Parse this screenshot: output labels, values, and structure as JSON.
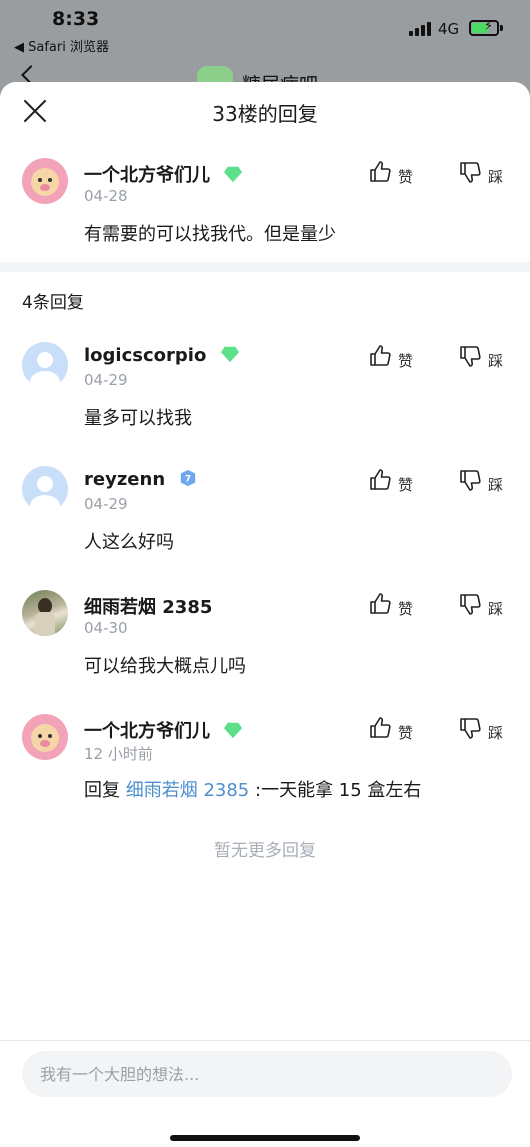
{
  "status": {
    "time": "8:33",
    "back_app": "◀ Safari 浏览器",
    "network": "4G"
  },
  "background": {
    "title": "糖尿病吧"
  },
  "sheet": {
    "title": "33楼的回复",
    "reply_count": "4条回复",
    "no_more": "暂无更多回复",
    "input_placeholder": "我有一个大胆的想法..."
  },
  "main_comment": {
    "user": "一个北方爷们儿",
    "date": "04-28",
    "text": "有需要的可以找我代。但是量少",
    "badge_color": "#5ee08a"
  },
  "replies": [
    {
      "user": "logicscorpio",
      "date": "04-29",
      "text": "量多可以找我",
      "badge_color": "#5ee08a"
    },
    {
      "user": "reyzenn",
      "date": "04-29",
      "text": "人这么好吗",
      "badge_color": "#6ea8f0"
    },
    {
      "user": "细雨若烟 2385",
      "date": "04-30",
      "text": "可以给我大概点儿吗",
      "badge_color": ""
    },
    {
      "user": "一个北方爷们儿",
      "date": "12 小时前",
      "text_prefix": "回复",
      "reply_to": "细雨若烟 2385",
      "text_suffix": ":一天能拿 15 盒左右",
      "badge_color": "#5ee08a"
    }
  ],
  "actions": {
    "like_label": "赞",
    "dislike_label": "踩"
  }
}
